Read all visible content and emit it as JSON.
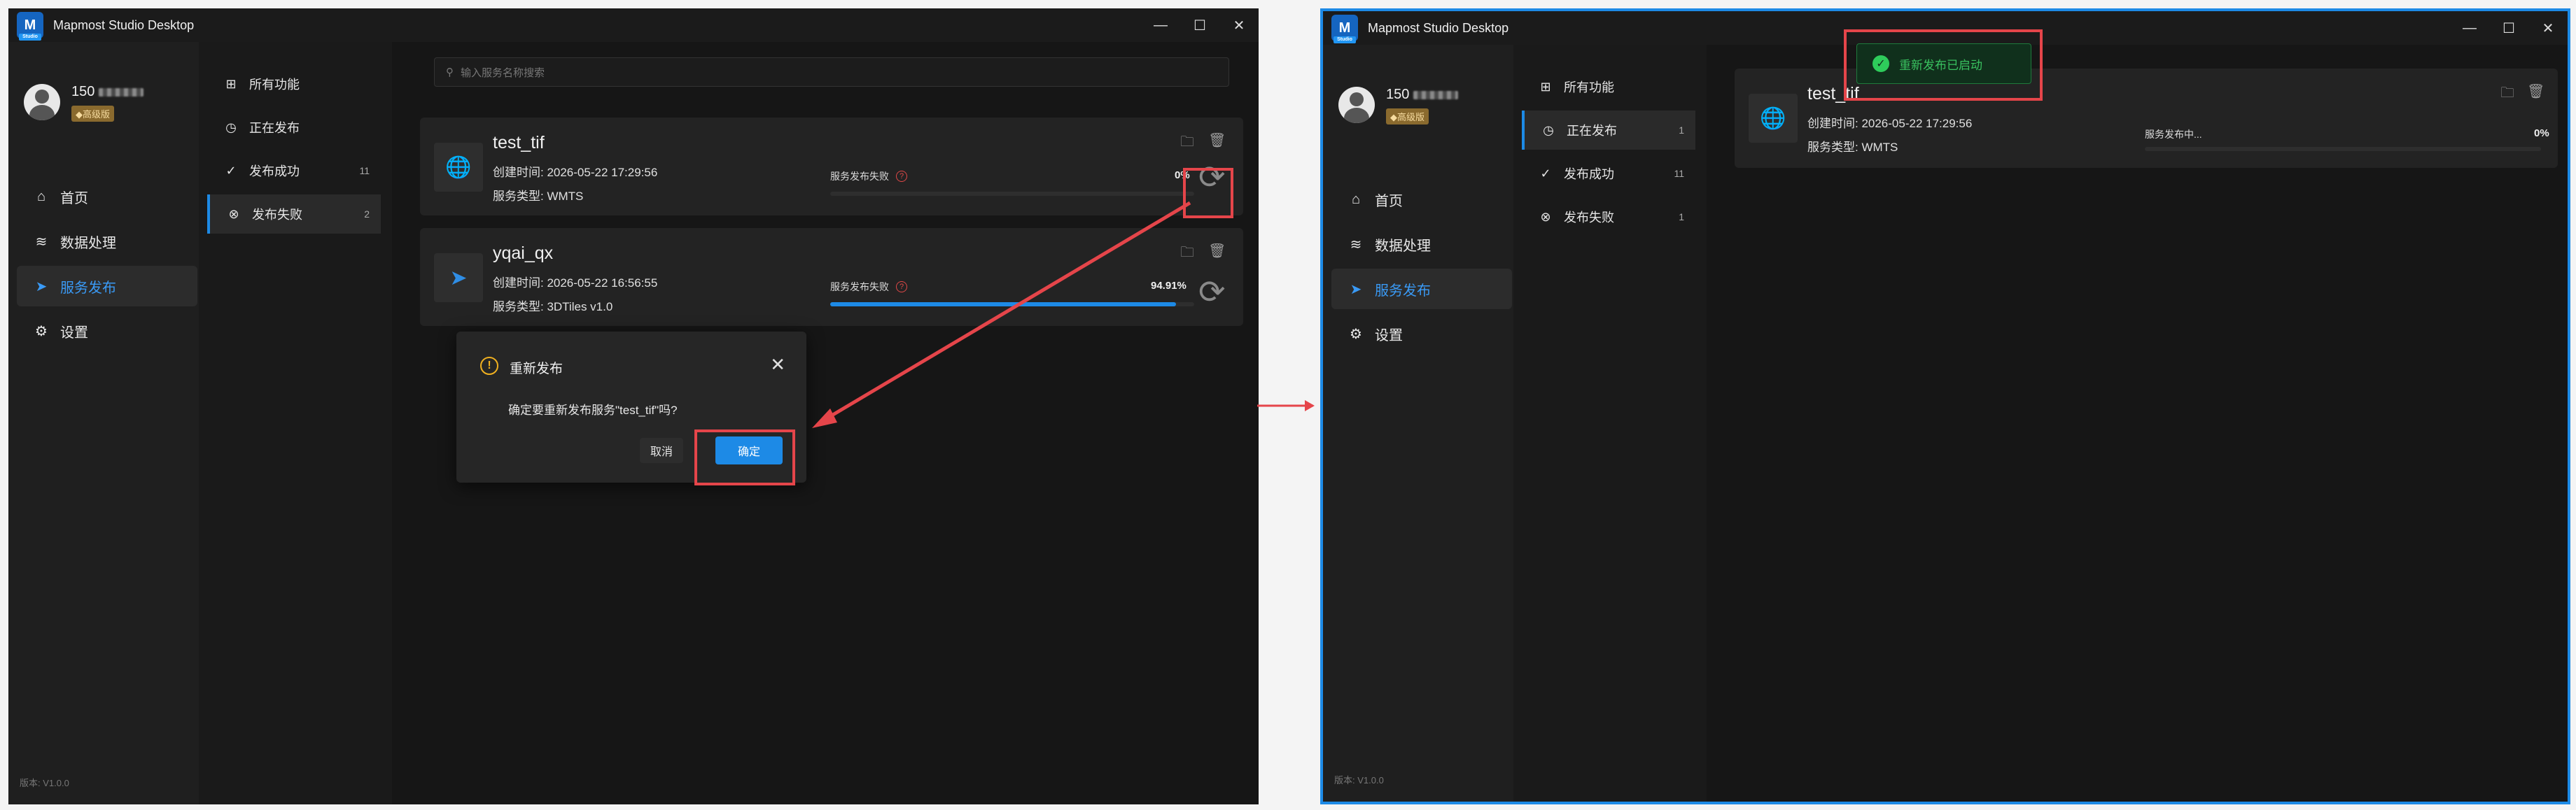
{
  "app": {
    "title": "Mapmost Studio Desktop",
    "logo_text": "M",
    "logo_sub": "Studio"
  },
  "window_controls": {
    "minimize": "—",
    "maximize": "☐",
    "close": "✕"
  },
  "user": {
    "name": "150",
    "badge": "◆高级版"
  },
  "nav": [
    {
      "label": "首页",
      "icon": "home-icon",
      "glyph": "⌂"
    },
    {
      "label": "数据处理",
      "icon": "database-icon",
      "glyph": "≋"
    },
    {
      "label": "服务发布",
      "icon": "send-icon",
      "glyph": "➤"
    },
    {
      "label": "设置",
      "icon": "gear-icon",
      "glyph": "⚙"
    }
  ],
  "version": "版本: V1.0.0",
  "subnav": [
    {
      "label": "所有功能",
      "count": "",
      "icon": "grid-icon",
      "glyph": "⊞"
    },
    {
      "label": "正在发布",
      "count": "",
      "icon": "clock-icon",
      "glyph": "◷"
    },
    {
      "label": "发布成功",
      "count": "11",
      "icon": "check-circle-icon",
      "glyph": "✓"
    },
    {
      "label": "发布失败",
      "count": "2",
      "icon": "x-circle-icon",
      "glyph": "⊗"
    }
  ],
  "subnav_right": [
    {
      "label": "所有功能",
      "count": "",
      "glyph": "⊞"
    },
    {
      "label": "正在发布",
      "count": "1",
      "glyph": "◷"
    },
    {
      "label": "发布成功",
      "count": "11",
      "glyph": "✓"
    },
    {
      "label": "发布失败",
      "count": "1",
      "glyph": "⊗"
    }
  ],
  "search": {
    "placeholder": "输入服务名称搜索",
    "icon": "⚲"
  },
  "left_cards": [
    {
      "name": "test_tif",
      "time": "创建时间: 2026-05-22 17:29:56",
      "type": "服务类型: WMTS",
      "status": "服务发布失败",
      "pct": "0%",
      "progress": 0,
      "icon_glyph": "🌐"
    },
    {
      "name": "yqai_qx",
      "time": "创建时间: 2026-05-22 16:56:55",
      "type": "服务类型: 3DTiles v1.0",
      "status": "服务发布失败",
      "pct": "94.91%",
      "progress": 0.9491,
      "icon_glyph": "➤"
    }
  ],
  "right_card": {
    "name": "test_tif",
    "time": "创建时间: 2026-05-22 17:29:56",
    "type": "服务类型: WMTS",
    "status": "服务发布中...",
    "pct": "0%",
    "progress": 0,
    "icon_glyph": "🌐"
  },
  "dialog": {
    "title": "重新发布",
    "message": "确定要重新发布服务\"test_tif\"吗?",
    "cancel": "取消",
    "ok": "确定",
    "warn_glyph": "!",
    "close_glyph": "✕"
  },
  "toast": {
    "text": "重新发布已启动",
    "glyph": "✓"
  },
  "colors": {
    "accent": "#1d8ae6",
    "highlight": "#e5454a",
    "success": "#39c15f"
  }
}
